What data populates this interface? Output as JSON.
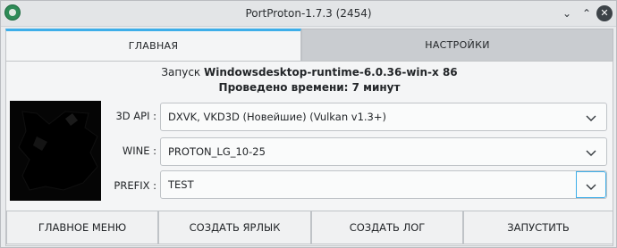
{
  "window": {
    "title": "PortProton-1.7.3 (2454)",
    "minimize_glyph": "⌄",
    "maximize_glyph": "⌃",
    "close_glyph": "✕"
  },
  "tabs": [
    {
      "label": "ГЛАВНАЯ",
      "active": true
    },
    {
      "label": "НАСТРОЙКИ",
      "active": false
    }
  ],
  "info": {
    "launch_prefix": "Запуск ",
    "launch_target": "Windowsdesktop-runtime-6.0.36-win-x 86",
    "time_spent": "Проведено времени: 7 минут"
  },
  "settings": {
    "api": {
      "label": "3D API :",
      "value": "DXVK, VKD3D (Новейшие) (Vulkan v1.3+)"
    },
    "wine": {
      "label": "WINE :",
      "value": "PROTON_LG_10-25"
    },
    "prefix": {
      "label": "PREFIX :",
      "value": "TEST"
    }
  },
  "buttons": {
    "main_menu": "ГЛАВНОЕ МЕНЮ",
    "create_shortcut": "СОЗДАТЬ ЯРЛЫК",
    "create_log": "СОЗДАТЬ ЛОГ",
    "launch": "ЗАПУСТИТЬ"
  },
  "colors": {
    "accent": "#3daee9",
    "window_bg": "#e9ebed",
    "panel_bg": "#f4f5f6"
  },
  "icons": {
    "app": "portproton-app-icon",
    "combo_arrow": "chevron-down-icon"
  }
}
